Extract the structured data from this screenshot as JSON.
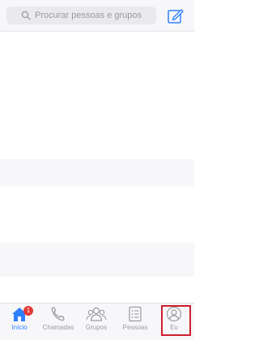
{
  "search": {
    "placeholder": "Procurar pessoas e grupos",
    "icon": "search-icon"
  },
  "header": {
    "compose_icon": "compose-icon"
  },
  "tabs": [
    {
      "label": "Início",
      "icon": "home-icon",
      "active": true,
      "badge": "1"
    },
    {
      "label": "Chamadas",
      "icon": "phone-icon",
      "active": false
    },
    {
      "label": "Grupos",
      "icon": "groups-icon",
      "active": false
    },
    {
      "label": "Pessoas",
      "icon": "contacts-icon",
      "active": false
    },
    {
      "label": "Eu",
      "icon": "profile-icon",
      "active": false,
      "highlighted": true
    }
  ],
  "colors": {
    "accent": "#2f80ff",
    "badge": "#e53935",
    "highlight": "#d01f2f"
  }
}
